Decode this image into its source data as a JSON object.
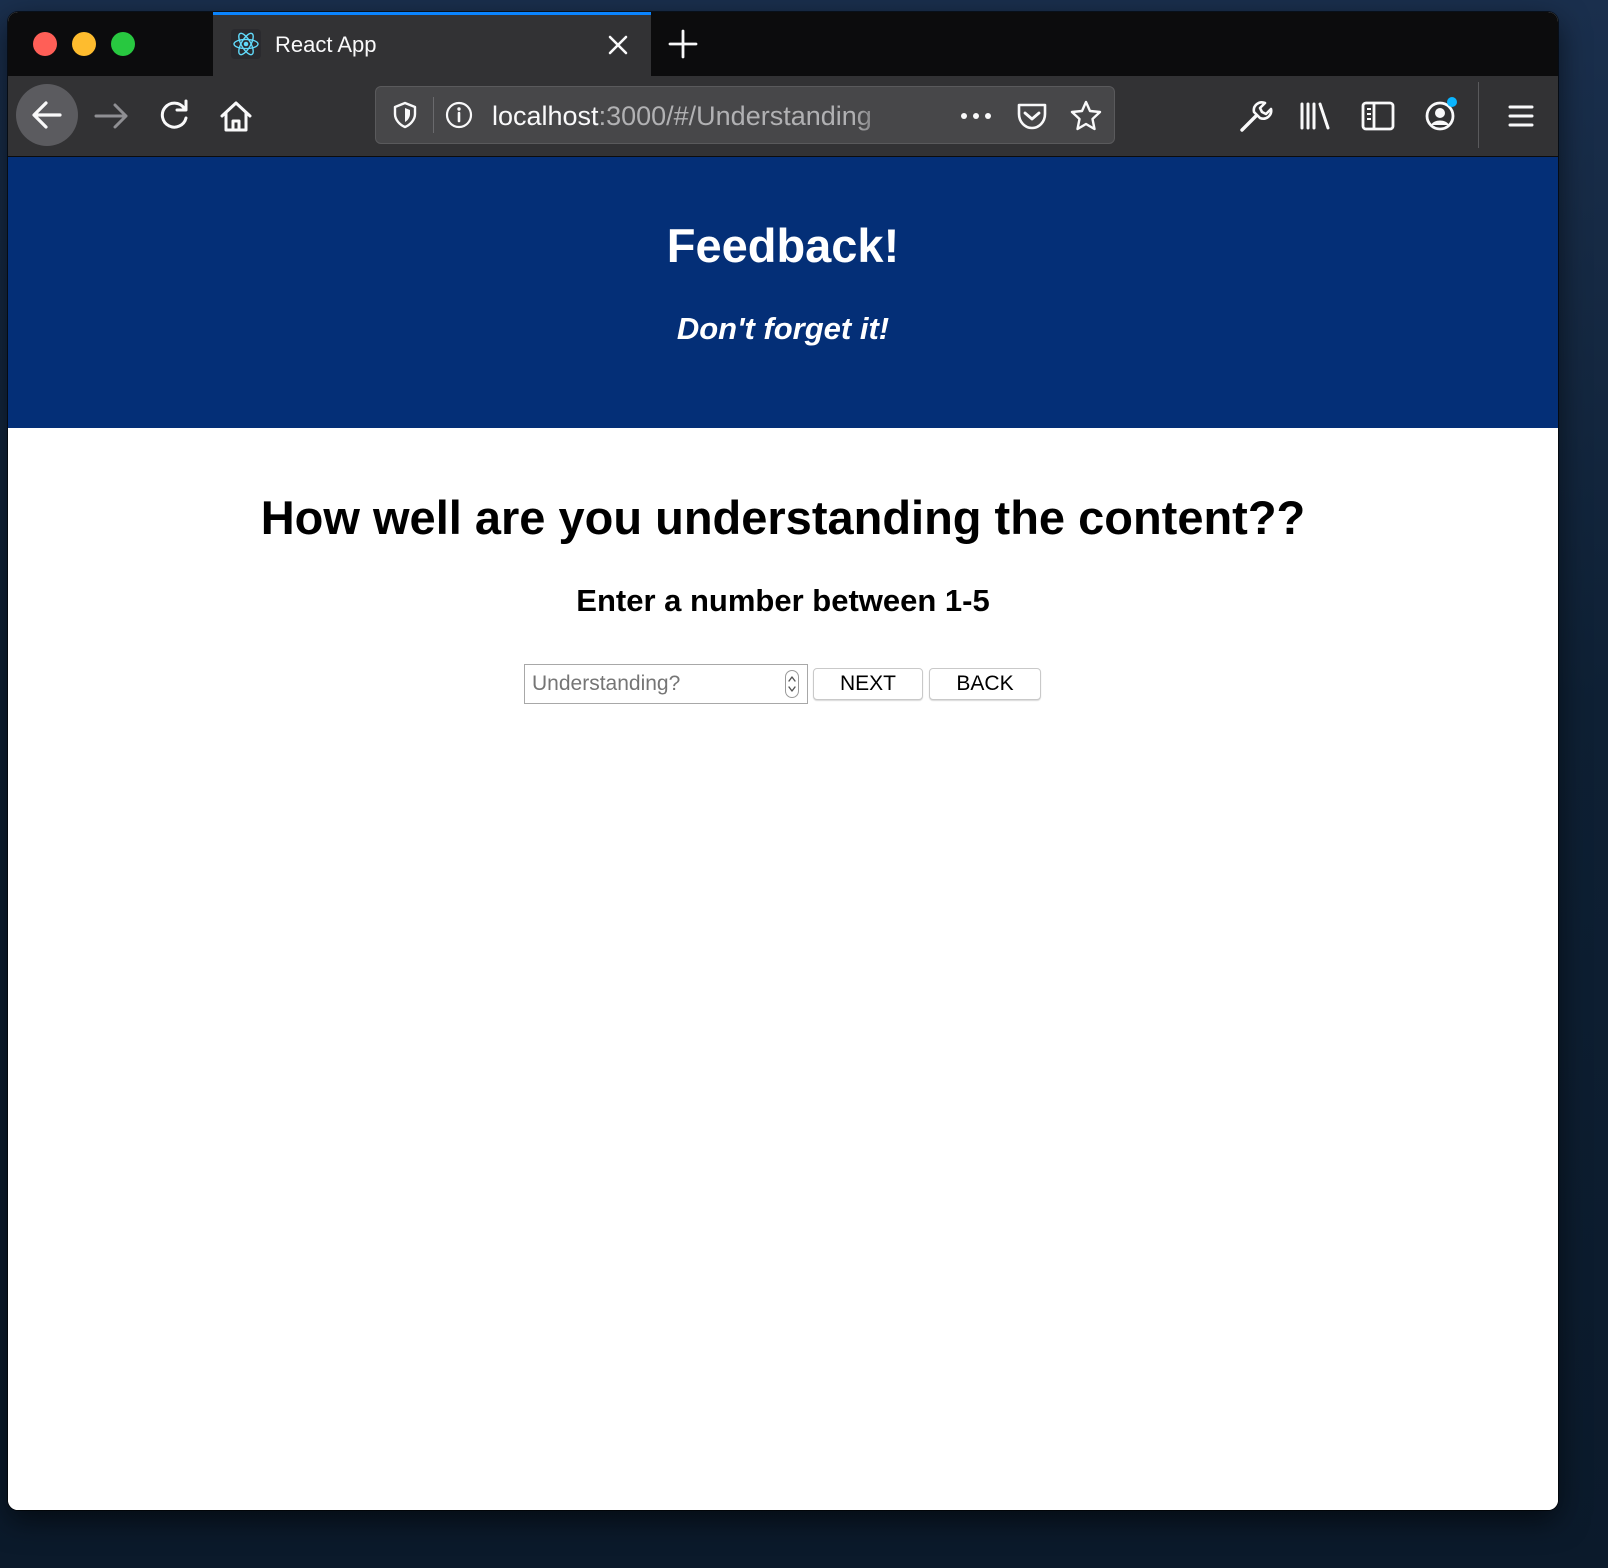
{
  "browser": {
    "tab": {
      "title": "React App",
      "favicon": "react-icon"
    },
    "url": {
      "host": "localhost",
      "path": ":3000/#/Understanding"
    },
    "colors": {
      "tab_accent": "#0a84ff",
      "toolbar": "#323234",
      "tabstrip": "#0c0c0d"
    }
  },
  "header": {
    "title": "Feedback!",
    "subtitle": "Don't forget it!",
    "background": "#042f77"
  },
  "main": {
    "question": "How well are you understanding the content??",
    "instruction": "Enter a number between 1-5",
    "input": {
      "placeholder": "Understanding?",
      "value": ""
    },
    "buttons": {
      "next_label": "NEXT",
      "back_label": "BACK"
    }
  }
}
